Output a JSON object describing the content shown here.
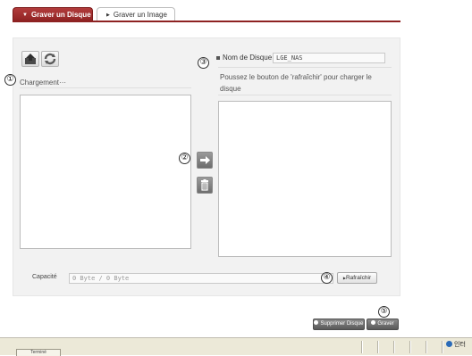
{
  "tabs": [
    {
      "label": "Graver un Disque",
      "active": true
    },
    {
      "label": "Graver un Image",
      "active": false
    }
  ],
  "left_panel": {
    "loading_label": "Chargement···"
  },
  "right_panel": {
    "disc_name_label": "Nom de Disque",
    "disc_name_value": "LGE_NAS",
    "hint": "Poussez le bouton de 'rafraîchir' pour charger le disque"
  },
  "capacity": {
    "label": "Capacité",
    "value": "0 Byte / 0 Byte",
    "refresh_label": "Rafraîchir"
  },
  "actions": {
    "delete_label": "Supprimer Disque",
    "burn_label": "Graver"
  },
  "markers": [
    "①",
    "②",
    "③",
    "④",
    "⑤"
  ],
  "statusbar": {
    "zone_text": "인터",
    "tab_text": "Terminé"
  },
  "colors": {
    "accent": "#9b2a2a",
    "panel_bg": "#f2f2f2"
  },
  "icons": [
    "upload-icon",
    "refresh-icon",
    "arrow-right-icon",
    "trash-icon",
    "square-bullet-icon",
    "globe-icon"
  ]
}
